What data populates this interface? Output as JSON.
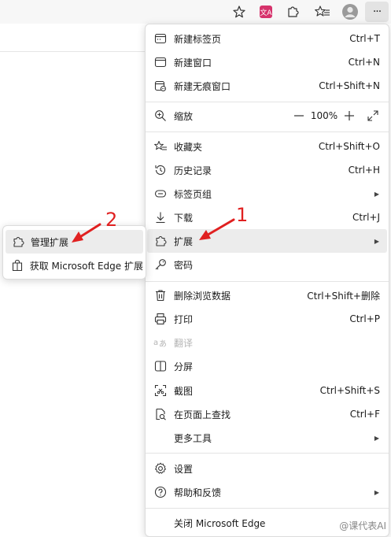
{
  "toolbar": {
    "icons": [
      "star-icon",
      "translate-icon",
      "extensions-icon",
      "favorites-icon",
      "profile-icon",
      "more-icon"
    ],
    "translate_glyph": "文A",
    "more_glyph": "···"
  },
  "menu": {
    "items": [
      {
        "label": "新建标签页",
        "shortcut": "Ctrl+T",
        "icon": "new-tab-icon"
      },
      {
        "label": "新建窗口",
        "shortcut": "Ctrl+N",
        "icon": "new-window-icon"
      },
      {
        "label": "新建无痕窗口",
        "shortcut": "Ctrl+Shift+N",
        "icon": "inprivate-icon"
      },
      {
        "label": "缩放",
        "zoom_value": "100%",
        "icon": "zoom-icon"
      },
      {
        "label": "收藏夹",
        "shortcut": "Ctrl+Shift+O",
        "icon": "favorites-icon"
      },
      {
        "label": "历史记录",
        "shortcut": "Ctrl+H",
        "icon": "history-icon"
      },
      {
        "label": "标签页组",
        "icon": "tab-groups-icon"
      },
      {
        "label": "下载",
        "shortcut": "Ctrl+J",
        "icon": "download-icon"
      },
      {
        "label": "扩展",
        "icon": "extensions-icon"
      },
      {
        "label": "密码",
        "icon": "key-icon"
      },
      {
        "label": "删除浏览数据",
        "shortcut": "Ctrl+Shift+删除",
        "icon": "trash-icon"
      },
      {
        "label": "打印",
        "shortcut": "Ctrl+P",
        "icon": "print-icon"
      },
      {
        "label": "翻译",
        "icon": "translate-icon"
      },
      {
        "label": "分屏",
        "icon": "split-screen-icon"
      },
      {
        "label": "截图",
        "shortcut": "Ctrl+Shift+S",
        "icon": "screenshot-icon"
      },
      {
        "label": "在页面上查找",
        "shortcut": "Ctrl+F",
        "icon": "find-icon"
      },
      {
        "label": "更多工具",
        "icon": ""
      },
      {
        "label": "设置",
        "icon": "settings-icon"
      },
      {
        "label": "帮助和反馈",
        "icon": "help-icon"
      },
      {
        "label": "关闭 Microsoft Edge",
        "icon": ""
      }
    ]
  },
  "submenu": {
    "items": [
      {
        "label": "管理扩展",
        "icon": "extensions-icon"
      },
      {
        "label": "获取 Microsoft Edge 扩展",
        "icon": "store-icon"
      }
    ]
  },
  "annotations": {
    "label_1": "1",
    "label_2": "2",
    "color": "#e02020"
  },
  "watermark": {
    "text": "@课代表AI"
  }
}
